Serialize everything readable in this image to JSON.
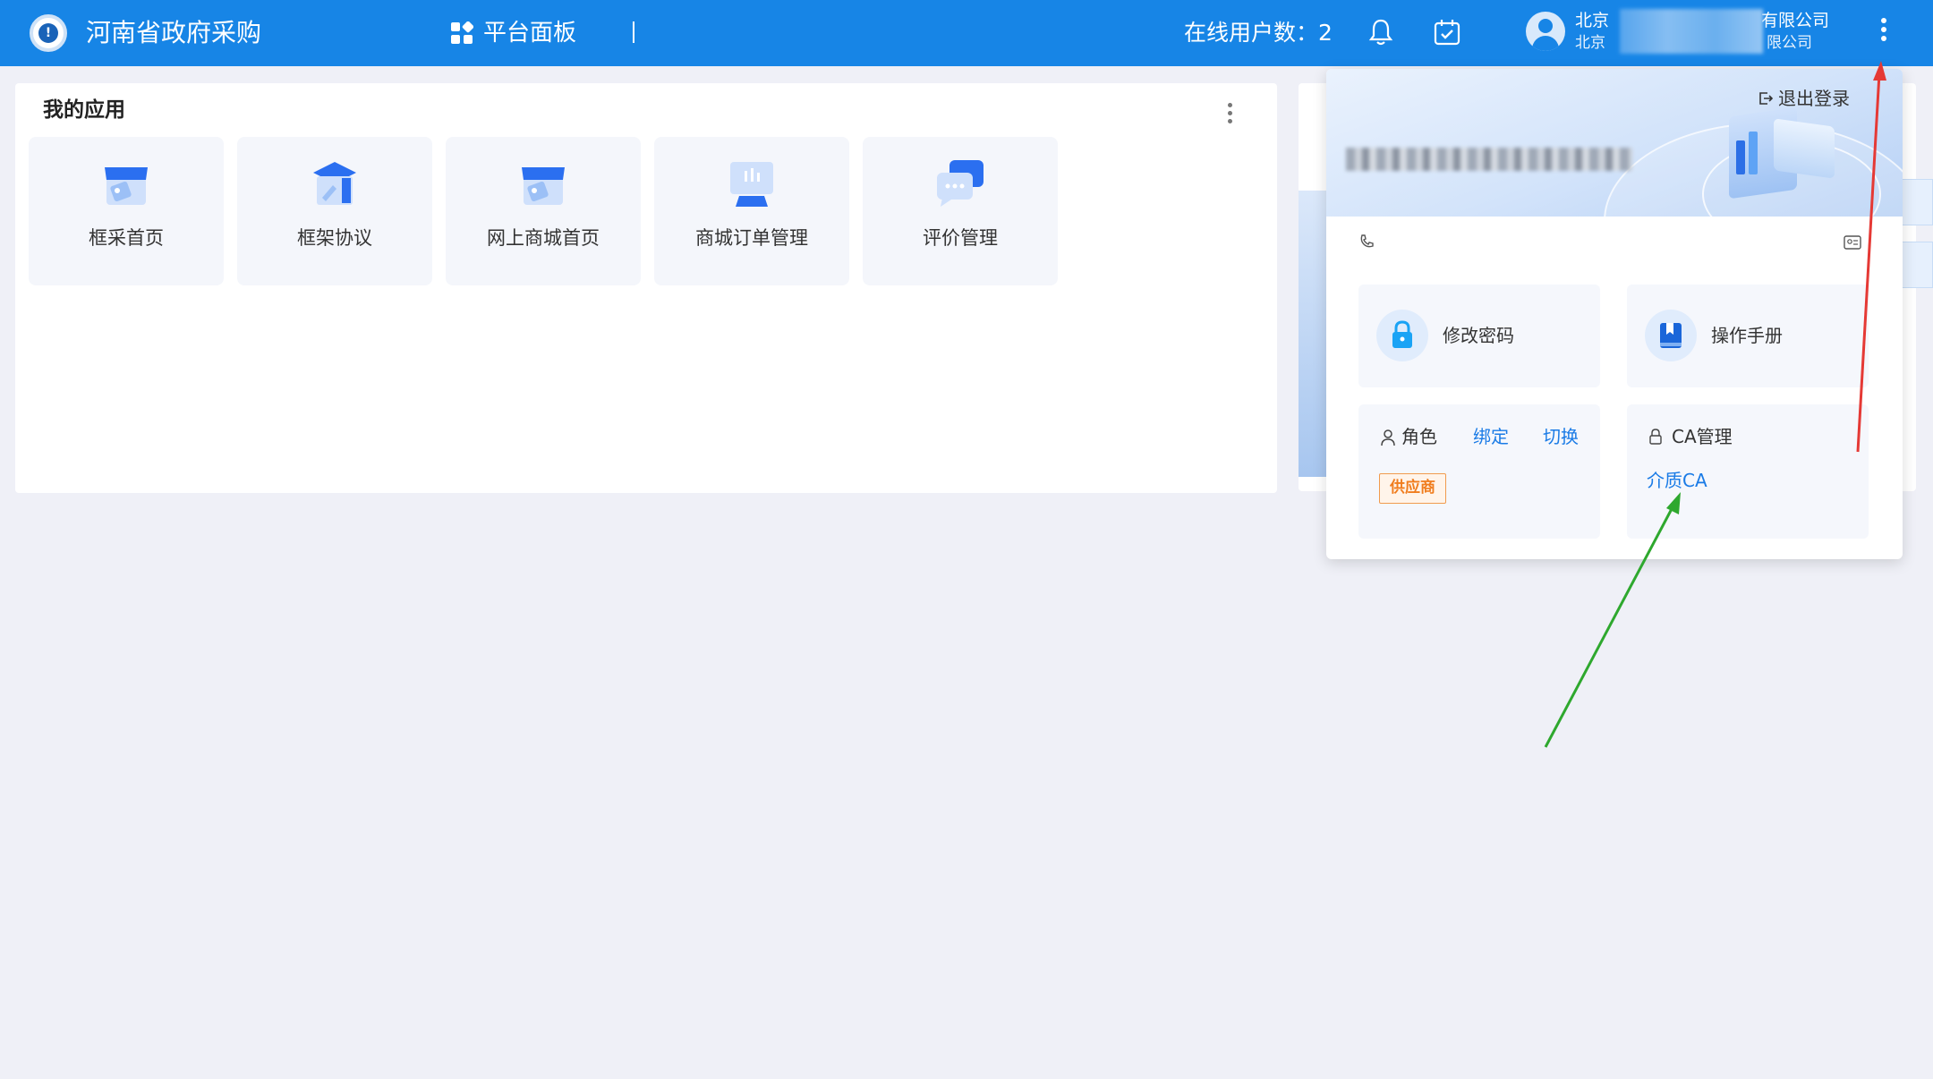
{
  "header": {
    "title": "河南省政府采购",
    "dashboard_label": "平台面板",
    "online_users_label": "在线用户数：",
    "online_users_count": "2",
    "user_company_line1": "北京",
    "user_company_suffix": "有限公司",
    "user_company_line2": "北京",
    "user_company_line2_suffix": "限公司"
  },
  "apps_card": {
    "title": "我的应用",
    "tiles": [
      {
        "label": "框采首页",
        "icon": "store-icon"
      },
      {
        "label": "框架协议",
        "icon": "agreement-icon"
      },
      {
        "label": "网上商城首页",
        "icon": "store-icon"
      },
      {
        "label": "商城订单管理",
        "icon": "monitor-icon"
      },
      {
        "label": "评价管理",
        "icon": "chat-icon"
      }
    ]
  },
  "user_panel": {
    "logout_label": "退出登录",
    "change_password": "修改密码",
    "manual": "操作手册",
    "role_label": "角色",
    "bind_label": "绑定",
    "switch_label": "切换",
    "role_tag": "供应商",
    "ca_label": "CA管理",
    "ca_link": "介质CA"
  },
  "colors": {
    "topbar": "#1785e6",
    "link": "#1a7be6",
    "tag": "#f07d1e",
    "arrow_red": "#e53935",
    "arrow_green": "#2ea82e"
  }
}
